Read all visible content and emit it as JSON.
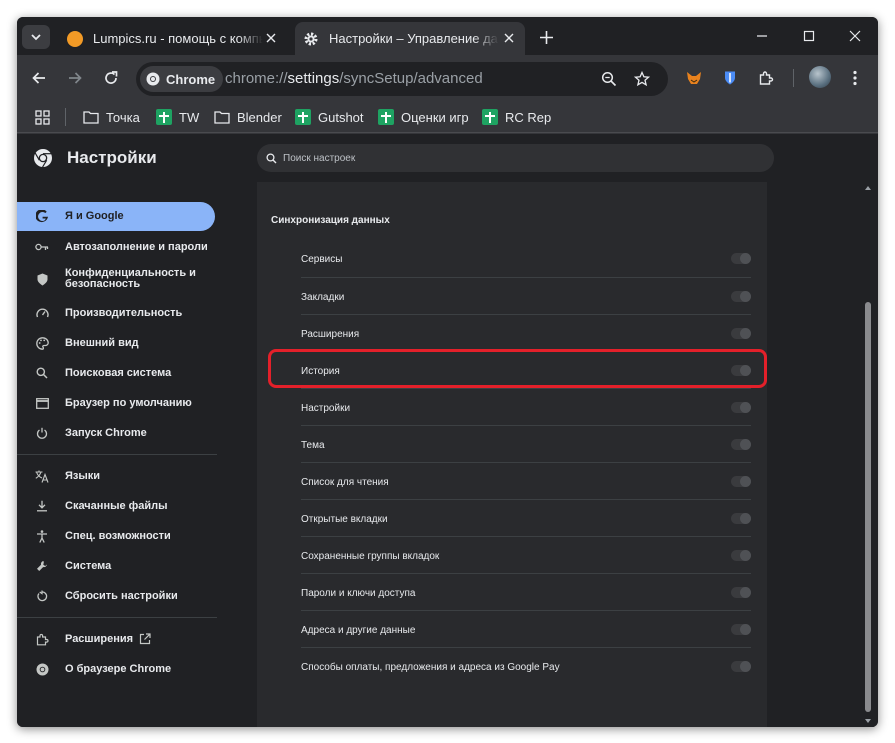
{
  "tabs": [
    {
      "title": "Lumpics.ru - помощь с компьютером",
      "favicon": "orange-circle-icon"
    },
    {
      "title": "Настройки – Управление данными синхронизации",
      "favicon": "gear-icon"
    }
  ],
  "toolbar": {
    "chip_label": "Chrome",
    "url_scheme": "chrome://",
    "url_host": "settings",
    "url_path": "/syncSetup/advanced"
  },
  "bookmarks": [
    {
      "label": "Точка",
      "icon": "folder-icon"
    },
    {
      "label": "TW",
      "icon": "sheets-icon"
    },
    {
      "label": "Blender",
      "icon": "folder-icon"
    },
    {
      "label": "Gutshot",
      "icon": "sheets-icon"
    },
    {
      "label": "Оценки игр",
      "icon": "sheets-icon"
    },
    {
      "label": "RC Rep",
      "icon": "sheets-icon"
    }
  ],
  "settings": {
    "title": "Настройки",
    "search_placeholder": "Поиск настроек"
  },
  "sidebar": {
    "items": [
      {
        "label": "Я и Google",
        "icon": "google-icon"
      },
      {
        "label": "Автозаполнение и пароли",
        "icon": "key-icon"
      },
      {
        "label": "Конфиденциальность и безопасность",
        "icon": "shield-icon"
      },
      {
        "label": "Производительность",
        "icon": "speedometer-icon"
      },
      {
        "label": "Внешний вид",
        "icon": "palette-icon"
      },
      {
        "label": "Поисковая система",
        "icon": "search-icon"
      },
      {
        "label": "Браузер по умолчанию",
        "icon": "browser-icon"
      },
      {
        "label": "Запуск Chrome",
        "icon": "power-icon"
      },
      {
        "label": "Языки",
        "icon": "translate-icon"
      },
      {
        "label": "Скачанные файлы",
        "icon": "download-icon"
      },
      {
        "label": "Спец. возможности",
        "icon": "accessibility-icon"
      },
      {
        "label": "Система",
        "icon": "wrench-icon"
      },
      {
        "label": "Сбросить настройки",
        "icon": "reset-icon"
      },
      {
        "label": "Расширения",
        "icon": "puzzle-icon"
      },
      {
        "label": "О браузере Chrome",
        "icon": "chrome-icon"
      }
    ],
    "active_index": 0
  },
  "sync": {
    "section_title": "Синхронизация данных",
    "rows": [
      {
        "label": "Сервисы",
        "checked": false
      },
      {
        "label": "Закладки",
        "checked": false
      },
      {
        "label": "Расширения",
        "checked": false
      },
      {
        "label": "История",
        "checked": false
      },
      {
        "label": "Настройки",
        "checked": false
      },
      {
        "label": "Тема",
        "checked": false
      },
      {
        "label": "Список для чтения",
        "checked": false
      },
      {
        "label": "Открытые вкладки",
        "checked": false
      },
      {
        "label": "Сохраненные группы вкладок",
        "checked": false
      },
      {
        "label": "Пароли и ключи доступа",
        "checked": false
      },
      {
        "label": "Адреса и другие данные",
        "checked": false
      },
      {
        "label": "Способы оплаты, предложения и адреса из Google Pay",
        "checked": false
      }
    ],
    "highlighted_row": "История"
  },
  "colors": {
    "accent": "#8ab4f8",
    "highlight": "#e3202a",
    "page_bg": "#202124",
    "card_bg": "#292a2d"
  }
}
